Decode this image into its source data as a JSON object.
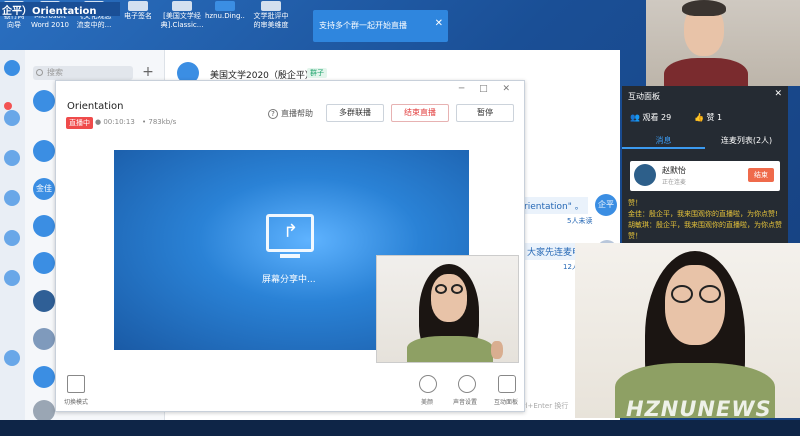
{
  "desktop": {
    "window_title": "企平）Orientation",
    "icons": [
      {
        "label": "银行网\n向导"
      },
      {
        "label": "Microsoft\nWord 2010"
      },
      {
        "label": "《文化观念\n流变中的..."
      },
      {
        "label": "电子签名"
      },
      {
        "label": "[美国文学经\n典].Classic..."
      },
      {
        "label": "hznu.Ding..."
      },
      {
        "label": "文学批评中\n的审美维度"
      }
    ]
  },
  "notice": {
    "text": "支持多个群一起开始直播",
    "close": "✕"
  },
  "chat_list": {
    "search_placeholder": "搜索",
    "add": "+",
    "avatar_label": "金佳"
  },
  "chat": {
    "title": "美国文学2020（殷企平）",
    "tag": "群子",
    "msg_orientation": "rientation\" 。",
    "msg_read1": "5人未读",
    "me_avatar": "企平",
    "msg_invite": "大家先连麦申",
    "msg_read2": "12人",
    "hint": "Ctrl+Enter 换行"
  },
  "live": {
    "title": "Orientation",
    "live_badge": "直播中",
    "time": "00:10:13",
    "rate": "783kb/s",
    "help": "直播帮助",
    "btn_multi": "多群联播",
    "btn_end": "结束直播",
    "btn_pause": "暂停",
    "screen_text": "屏幕分享中...",
    "footer": {
      "switch": "切换模式",
      "beauty": "美颜",
      "audio": "声音设置",
      "interact": "互动面板"
    }
  },
  "panel": {
    "title": "互动面板",
    "close": "✕",
    "viewers": "观看 29",
    "likes": "赞 1",
    "tab_messages": "消息",
    "tab_mic_list": "连麦列表(2人)",
    "user_name": "赵默怡",
    "user_sub": "正在连麦",
    "user_end": "结束",
    "msgs": [
      "赞！",
      "金佳：殷企平，我来围观你的直播啦，为你点赞!",
      "胡敏琪：殷企平，我来围观你的直播啦，为你点赞",
      "赞！"
    ]
  },
  "watermark": "HZNUNEWS"
}
